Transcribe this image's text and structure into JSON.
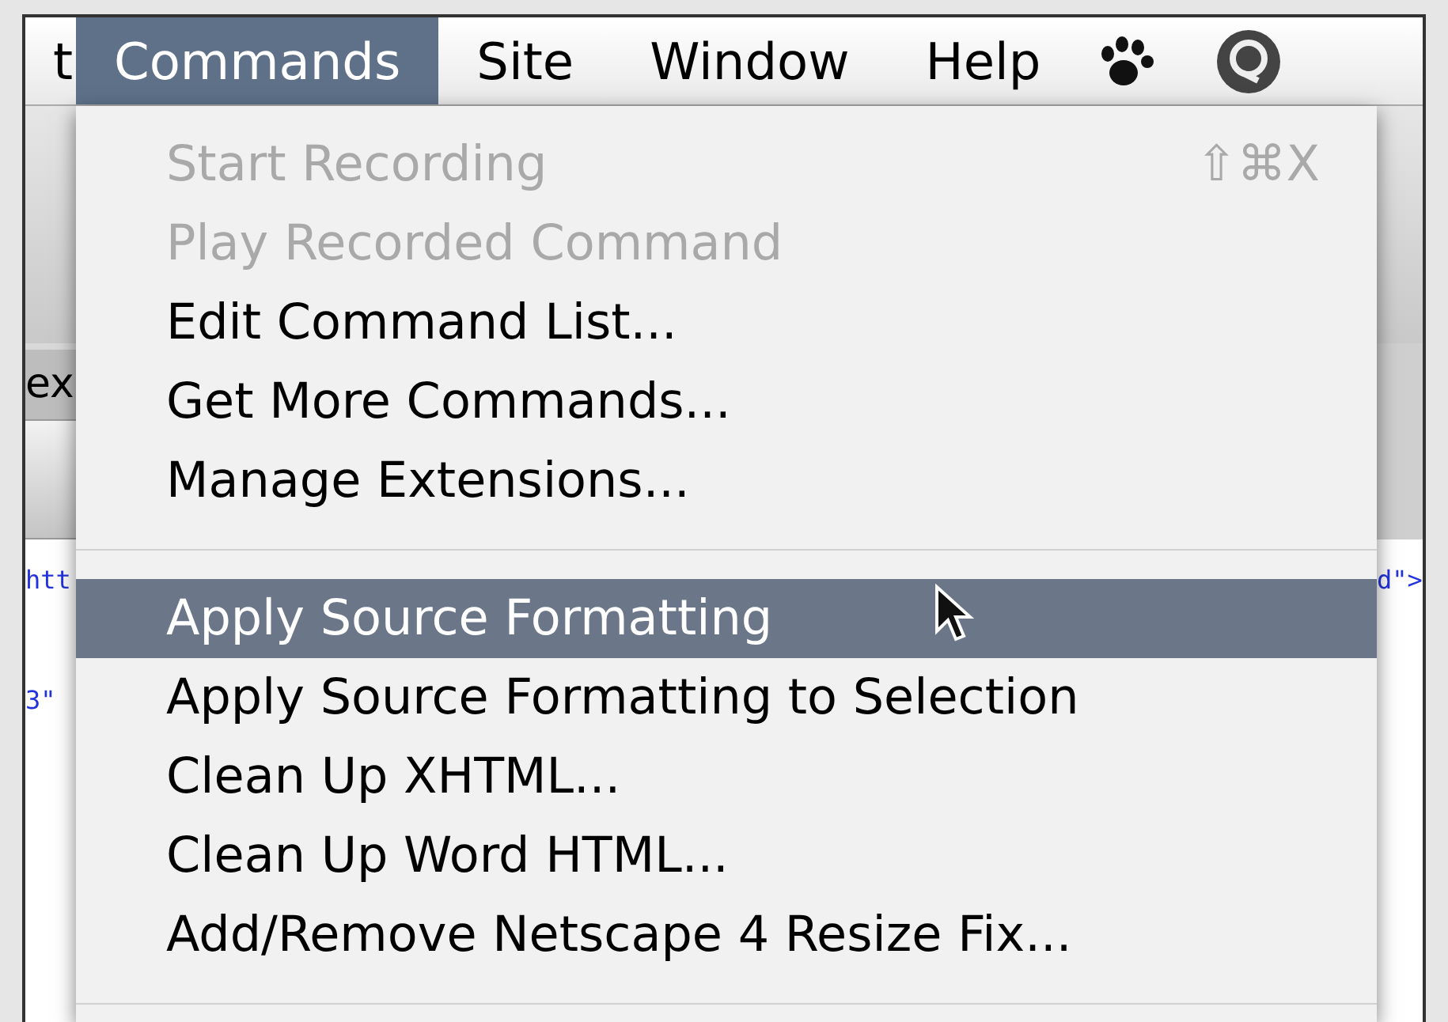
{
  "menubar": {
    "items": [
      {
        "label": "t",
        "selected": false
      },
      {
        "label": "Commands",
        "selected": true
      },
      {
        "label": "Site",
        "selected": false
      },
      {
        "label": "Window",
        "selected": false
      },
      {
        "label": "Help",
        "selected": false
      }
    ]
  },
  "background": {
    "left_tab": "ex",
    "left_code": [
      "htt",
      "3\""
    ],
    "right_code": [
      "d\">"
    ]
  },
  "menu": {
    "items": [
      {
        "kind": "item",
        "label": "Start Recording",
        "shortcut": "⇧⌘X",
        "disabled": true,
        "selected": false
      },
      {
        "kind": "item",
        "label": "Play Recorded Command",
        "disabled": true,
        "selected": false
      },
      {
        "kind": "item",
        "label": "Edit Command List...",
        "disabled": false,
        "selected": false
      },
      {
        "kind": "item",
        "label": "Get More Commands...",
        "disabled": false,
        "selected": false
      },
      {
        "kind": "item",
        "label": "Manage Extensions...",
        "disabled": false,
        "selected": false
      },
      {
        "kind": "separator"
      },
      {
        "kind": "item",
        "label": "Apply Source Formatting",
        "disabled": false,
        "selected": true
      },
      {
        "kind": "item",
        "label": "Apply Source Formatting to Selection",
        "disabled": false,
        "selected": false
      },
      {
        "kind": "item",
        "label": "Clean Up XHTML...",
        "disabled": false,
        "selected": false
      },
      {
        "kind": "item",
        "label": "Clean Up Word HTML...",
        "disabled": false,
        "selected": false
      },
      {
        "kind": "item",
        "label": "Add/Remove Netscape 4 Resize Fix...",
        "disabled": false,
        "selected": false
      },
      {
        "kind": "separator"
      }
    ]
  }
}
